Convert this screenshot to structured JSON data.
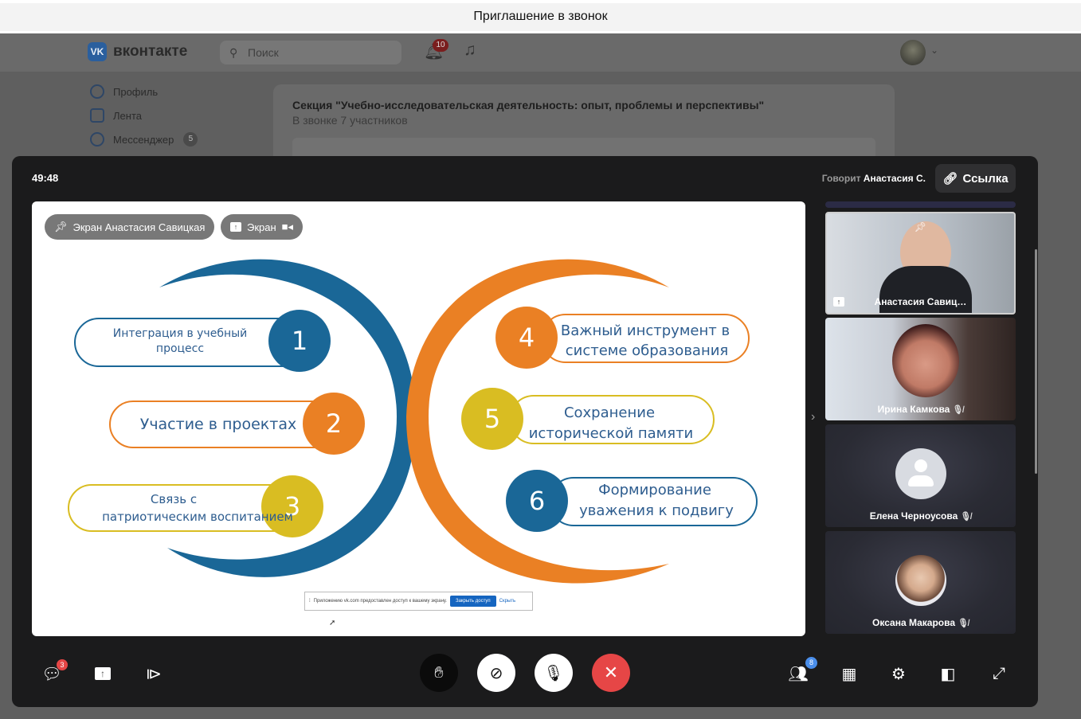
{
  "window": {
    "title": "Приглашение в звонок"
  },
  "vk": {
    "logo": "VK",
    "brand": "вконтакте",
    "search_placeholder": "Поиск",
    "notifications_count": "10",
    "sidebar": [
      {
        "label": "Профиль",
        "icon": "profile-icon"
      },
      {
        "label": "Лента",
        "icon": "feed-icon"
      },
      {
        "label": "Мессенджер",
        "icon": "messenger-icon",
        "badge": "5"
      }
    ],
    "call_card": {
      "title": "Секция \"Учебно-исследовательская деятельность: опыт, проблемы и перспективы\"",
      "subtitle": "В звонке 7 участников"
    }
  },
  "call": {
    "timer": "49:48",
    "speaking_prefix": "Говорит",
    "speaking_name": "Анастасия С.",
    "link_label": "Ссылка",
    "stage_chips": {
      "pinned": "Экран Анастасия Савицкая",
      "screen": "Экран"
    },
    "slide": {
      "items": [
        {
          "num": "1",
          "lines": [
            "Интеграция в учебный",
            "процесс"
          ],
          "color": "#1a6797"
        },
        {
          "num": "2",
          "lines": [
            "Участие в проектах"
          ],
          "color": "#ea8024"
        },
        {
          "num": "3",
          "lines": [
            "Связь с",
            "патриотическим воспитанием"
          ],
          "color": "#d9bd22"
        },
        {
          "num": "4",
          "lines": [
            "Важный инструмент в",
            "системе образования"
          ],
          "color": "#ea8024"
        },
        {
          "num": "5",
          "lines": [
            "Сохранение",
            "исторической памяти"
          ],
          "color": "#d9bd22"
        },
        {
          "num": "6",
          "lines": [
            "Формирование",
            "уважения к подвигу"
          ],
          "color": "#1a6797"
        }
      ],
      "text_color": "#2e5d8f"
    },
    "share_notice": {
      "text": "Приложению vk.com предоставлен доступ к вашему экрану.",
      "stop": "Закрыть доступ",
      "hide": "Скрыть"
    },
    "participants": [
      {
        "name": "Анастасия Савиц…",
        "kind": "video"
      },
      {
        "name": "Ирина Камкова",
        "kind": "video",
        "muted": true
      },
      {
        "name": "Елена Черноусова",
        "kind": "placeholder",
        "muted": true
      },
      {
        "name": "Оксана Макарова",
        "kind": "photo",
        "muted": true
      }
    ],
    "controls": {
      "chat_badge": "3",
      "participants_badge": "8"
    },
    "colors": {
      "end_call": "#e64646",
      "accent": "#4a8eea"
    }
  }
}
